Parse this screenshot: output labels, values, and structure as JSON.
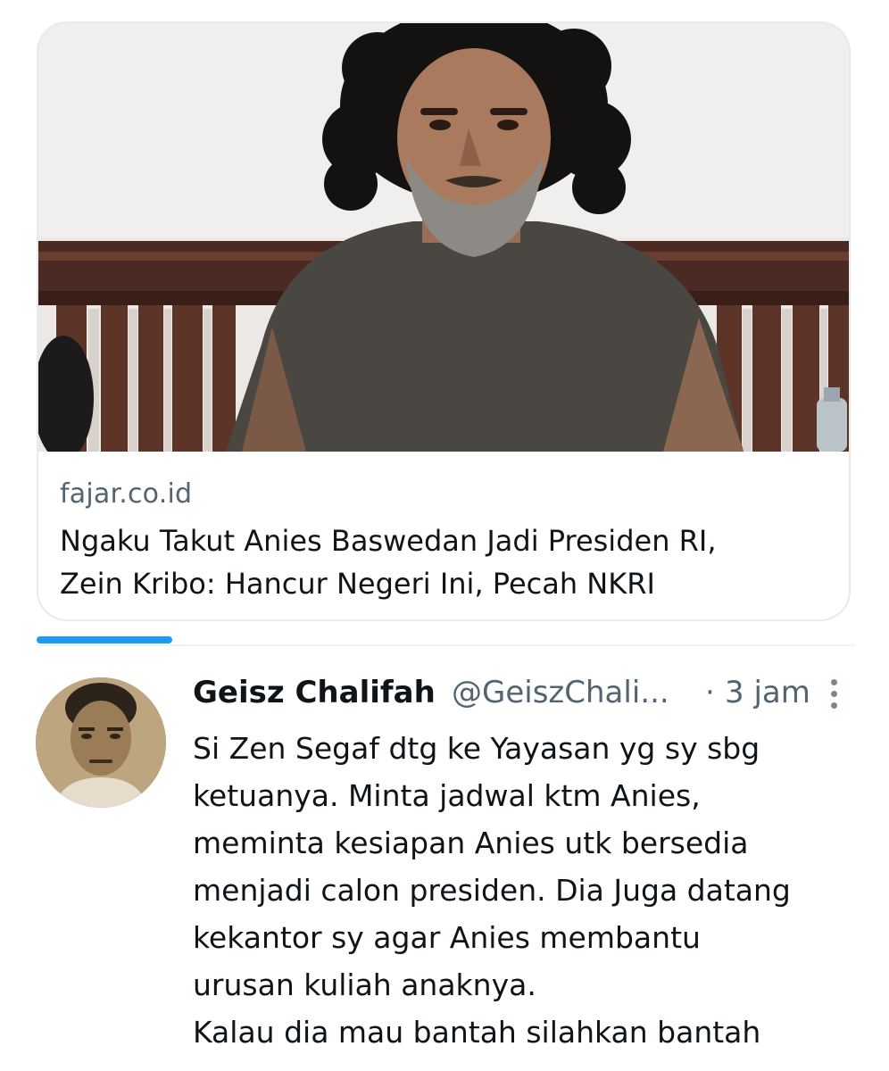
{
  "link_card": {
    "image_alt": "man with curly black hair and gray beard in dark t-shirt",
    "domain": "fajar.co.id",
    "title_lines": [
      "Ngaku Takut Anies Baswedan Jadi Presiden RI,",
      "Zein Kribo: Hancur Negeri Ini, Pecah NKRI"
    ]
  },
  "tweet": {
    "author_name": "Geisz Chalifah",
    "author_handle": "@GeiszChali...",
    "separator": "·",
    "time": "3 jam",
    "more_icon": "more-vertical-icon",
    "text_lines": [
      "Si Zen Segaf dtg ke Yayasan yg sy sbg",
      "ketuanya. Minta jadwal ktm Anies,",
      "meminta kesiapan Anies utk bersedia",
      "menjadi calon presiden. Dia Juga datang",
      "kekantor sy agar Anies membantu",
      "urusan kuliah anaknya.",
      "Kalau dia mau bantah silahkan bantah"
    ]
  },
  "colors": {
    "accent": "#1d9bf0",
    "secondary_text": "#536471",
    "primary_text": "#0f1419",
    "border": "#e7ebee"
  }
}
